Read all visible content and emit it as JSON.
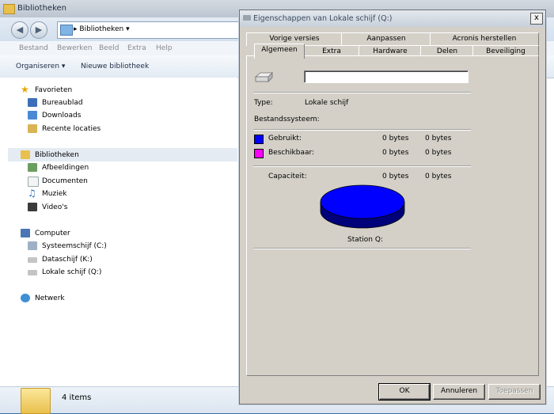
{
  "explorer": {
    "title": "Bibliotheken",
    "address": "Bibliotheken",
    "menu": [
      "Bestand",
      "Bewerken",
      "Beeld",
      "Extra",
      "Help"
    ],
    "commands": [
      "Organiseren",
      "Nieuwe bibliotheek"
    ],
    "nav": {
      "favorites": "Favorieten",
      "favorite_items": [
        "Bureaublad",
        "Downloads",
        "Recente locaties"
      ],
      "libraries": "Bibliotheken",
      "library_items": [
        "Afbeeldingen",
        "Documenten",
        "Muziek",
        "Video's"
      ],
      "computer": "Computer",
      "computer_items": [
        "Systeemschijf (C:)",
        "Dataschijf (K:)",
        "Lokale schijf (Q:)"
      ],
      "network": "Netwerk"
    },
    "status": "4 items"
  },
  "dialog": {
    "title": "Eigenschappen van Lokale schijf (Q:)",
    "close": "x",
    "tabs_back": [
      "Vorige versies",
      "Aanpassen",
      "Acronis herstellen"
    ],
    "tabs_front": [
      "Algemeen",
      "Extra",
      "Hardware",
      "Delen",
      "Beveiliging"
    ],
    "active_tab": "Algemeen",
    "name_value": "",
    "type_label": "Type:",
    "type_value": "Lokale schijf",
    "fs_label": "Bestandssysteem:",
    "fs_value": "",
    "used_label": "Gebruikt:",
    "used_bytes": "0 bytes",
    "used_size": "0 bytes",
    "free_label": "Beschikbaar:",
    "free_bytes": "0 bytes",
    "free_size": "0 bytes",
    "capacity_label": "Capaciteit:",
    "capacity_bytes": "0 bytes",
    "capacity_size": "0 bytes",
    "drive_label": "Station Q:",
    "buttons": {
      "ok": "OK",
      "cancel": "Annuleren",
      "apply": "Toepassen"
    },
    "colors": {
      "used": "#0000ff",
      "free": "#ff00ff"
    }
  }
}
